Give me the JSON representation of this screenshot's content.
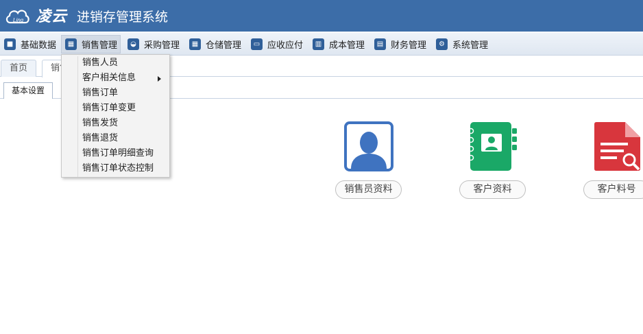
{
  "header": {
    "brand": "凌云",
    "logo_text": "Ling",
    "title": "进销存管理系统",
    "logo_icon": "cloud-logo-icon",
    "bg_color": "#3c6da8"
  },
  "menu": [
    {
      "label": "基础数据",
      "icon": "box-icon"
    },
    {
      "label": "销售管理",
      "icon": "calendar-icon",
      "active": true
    },
    {
      "label": "采购管理",
      "icon": "basket-icon"
    },
    {
      "label": "仓储管理",
      "icon": "calendar-icon"
    },
    {
      "label": "应收应付",
      "icon": "window-icon"
    },
    {
      "label": "成本管理",
      "icon": "book-icon"
    },
    {
      "label": "财务管理",
      "icon": "money-icon"
    },
    {
      "label": "系统管理",
      "icon": "gear-icon"
    }
  ],
  "tabs": [
    {
      "label": "首页"
    },
    {
      "label": "销售管理",
      "active": true
    }
  ],
  "subtabs": [
    {
      "label": "基本设置",
      "active": true
    }
  ],
  "dropdown": {
    "items": [
      {
        "label": "销售人员"
      },
      {
        "label": "客户相关信息",
        "has_submenu": true
      },
      {
        "label": "销售订单"
      },
      {
        "label": "销售订单变更"
      },
      {
        "label": "销售发货"
      },
      {
        "label": "销售退货"
      },
      {
        "label": "销售订单明细查询"
      },
      {
        "label": "销售订单状态控制"
      }
    ]
  },
  "cards": [
    {
      "label": "销售员资料",
      "icon": "salesperson-icon",
      "color": "#3f73c0"
    },
    {
      "label": "客户资料",
      "icon": "contact-book-icon",
      "color": "#1aa867"
    },
    {
      "label": "客户料号",
      "icon": "document-search-icon",
      "color": "#d8363d"
    }
  ]
}
